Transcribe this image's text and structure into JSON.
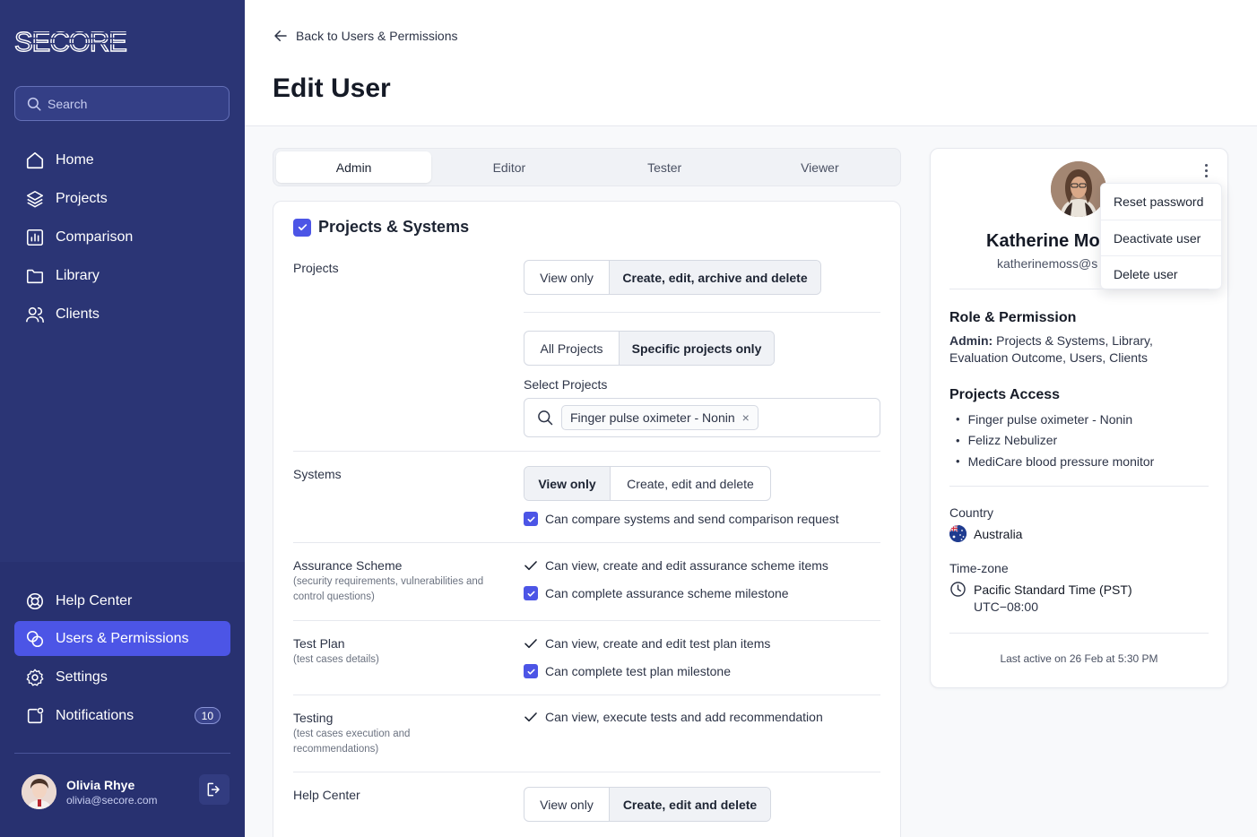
{
  "brand": {
    "logo_text": "SECORE"
  },
  "sidebar": {
    "search_placeholder": "Search",
    "items": [
      {
        "label": "Home",
        "icon": "home-icon"
      },
      {
        "label": "Projects",
        "icon": "layers-icon"
      },
      {
        "label": "Comparison",
        "icon": "bar-chart-icon"
      },
      {
        "label": "Library",
        "icon": "folder-icon"
      },
      {
        "label": "Clients",
        "icon": "users-icon"
      }
    ],
    "bottom_items": [
      {
        "label": "Help Center",
        "icon": "lifebuoy-icon"
      },
      {
        "label": "Users & Permissions",
        "icon": "users-permissions-icon",
        "active": true
      },
      {
        "label": "Settings",
        "icon": "gear-icon"
      },
      {
        "label": "Notifications",
        "icon": "notification-icon",
        "badge": "10"
      }
    ],
    "user": {
      "name": "Olivia Rhye",
      "email": "olivia@secore.com"
    }
  },
  "header": {
    "back_label": "Back to Users & Permissions",
    "title": "Edit User"
  },
  "role_tabs": {
    "admin": "Admin",
    "editor": "Editor",
    "tester": "Tester",
    "viewer": "Viewer",
    "selected": "Admin"
  },
  "permissions": {
    "section_title": "Projects & Systems",
    "projects": {
      "label": "Projects",
      "access_view": "View only",
      "access_full": "Create, edit, archive and delete",
      "scope_all": "All Projects",
      "scope_specific": "Specific projects only",
      "select_label": "Select Projects",
      "selected_chip": "Finger pulse oximeter - Nonin",
      "chip_remove": "×"
    },
    "systems": {
      "label": "Systems",
      "access_view": "View only",
      "access_full": "Create, edit and delete",
      "compare_option": "Can compare systems and send comparison request"
    },
    "assurance": {
      "label": "Assurance Scheme",
      "sub": "(security requirements, vulnerabilities and control questions)",
      "perm_view": "Can view, create and edit assurance scheme items",
      "perm_complete": "Can complete assurance scheme milestone"
    },
    "test_plan": {
      "label": "Test Plan",
      "sub": "(test cases details)",
      "perm_view": "Can view, create and edit test plan items",
      "perm_complete": "Can complete test plan milestone"
    },
    "testing": {
      "label": "Testing",
      "sub": "(test cases execution and recommendations)",
      "perm_view": "Can view, execute tests and add recommendation"
    },
    "help_center": {
      "label": "Help Center",
      "access_view": "View only",
      "access_full": "Create, edit and delete"
    }
  },
  "profile": {
    "name": "Katherine Mo",
    "email": "katherinemoss@s",
    "menu": {
      "reset": "Reset password",
      "deactivate": "Deactivate user",
      "delete": "Delete user"
    },
    "role_heading": "Role & Permission",
    "role_prefix": "Admin:",
    "role_text": " Projects & Systems, Library, Evaluation Outcome, Users, Clients",
    "access_heading": "Projects Access",
    "projects": [
      "Finger pulse oximeter - Nonin",
      "Felizz Nebulizer",
      "MediCare blood pressure monitor"
    ],
    "country_label": "Country",
    "country": "Australia",
    "timezone_label": "Time-zone",
    "timezone": "Pacific Standard Time (PST)",
    "utc": "UTC−08:00",
    "last_active": "Last active on 26 Feb at 5:30 PM"
  },
  "colors": {
    "sidebar": "#2b3575",
    "accent": "#4c55e6",
    "background": "#f8f9fb"
  }
}
